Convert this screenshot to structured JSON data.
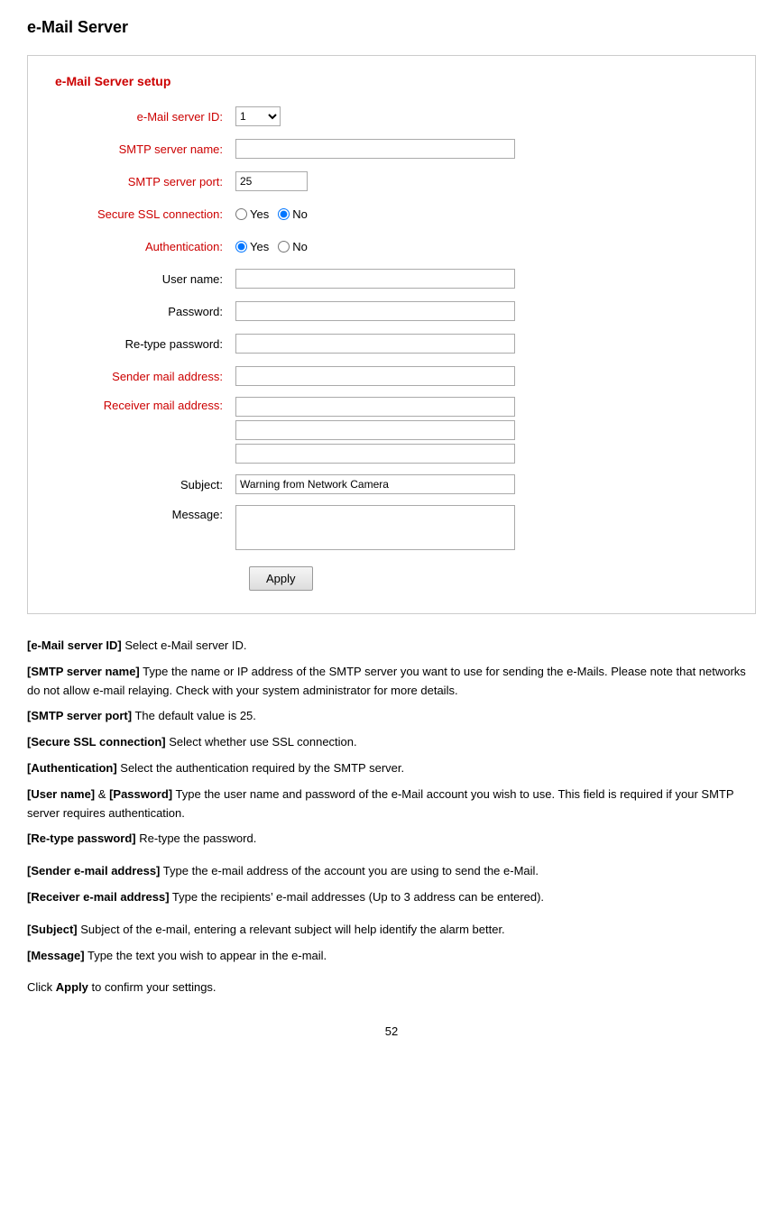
{
  "page": {
    "title": "e-Mail Server",
    "page_number": "52"
  },
  "section": {
    "title": "e-Mail Server setup"
  },
  "form": {
    "server_id_label": "e-Mail server ID:",
    "server_id_value": "1",
    "smtp_name_label": "SMTP server name:",
    "smtp_name_value": "",
    "smtp_port_label": "SMTP server port:",
    "smtp_port_value": "25",
    "ssl_label": "Secure SSL connection:",
    "ssl_yes": "Yes",
    "ssl_no": "No",
    "auth_label": "Authentication:",
    "auth_yes": "Yes",
    "auth_no": "No",
    "username_label": "User name:",
    "username_value": "",
    "password_label": "Password:",
    "password_value": "",
    "retype_label": "Re-type password:",
    "retype_value": "",
    "sender_label": "Sender mail address:",
    "sender_value": "",
    "receiver_label": "Receiver mail address:",
    "receiver1_value": "",
    "receiver2_value": "",
    "receiver3_value": "",
    "subject_label": "Subject:",
    "subject_value": "Warning from Network Camera",
    "message_label": "Message:",
    "message_value": "",
    "apply_label": "Apply"
  },
  "descriptions": [
    {
      "id": "desc1",
      "bold_part": "[e-Mail server ID]",
      "rest": " Select e-Mail server ID."
    },
    {
      "id": "desc2",
      "bold_part": "[SMTP server name]",
      "rest": " Type the name or IP address of the SMTP server you want to use for sending the e-Mails. Please note that networks do not allow e-mail relaying. Check with your system administrator for more details."
    },
    {
      "id": "desc3",
      "bold_part": "[SMTP server port]",
      "rest": " The default value is 25."
    },
    {
      "id": "desc4",
      "bold_part": "[Secure SSL connection]",
      "rest": " Select whether use SSL connection."
    },
    {
      "id": "desc5",
      "bold_part": "[Authentication]",
      "rest": " Select the authentication required by the SMTP server."
    },
    {
      "id": "desc6",
      "bold_part": "[User name]",
      "rest": " & "
    },
    {
      "id": "desc7",
      "bold_part": "[Re-type password]",
      "rest": " Re-type the password."
    },
    {
      "id": "desc8",
      "bold_part": "[Sender e-mail address]",
      "rest": " Type the e-mail address of the account you are using to send the e-Mail."
    },
    {
      "id": "desc9",
      "bold_part": "[Receiver e-mail address]",
      "rest": " Type the recipients’ e-mail addresses (Up to 3 address can be entered)."
    },
    {
      "id": "desc10",
      "bold_part": "[Subject]",
      "rest": " Subject of the e-mail, entering a relevant subject will help identify the alarm better."
    },
    {
      "id": "desc11",
      "bold_part": "[Message]",
      "rest": " Type the text you wish to appear in the e-mail."
    },
    {
      "id": "desc12",
      "bold_part": "",
      "rest": "Click Apply to confirm your settings."
    }
  ]
}
